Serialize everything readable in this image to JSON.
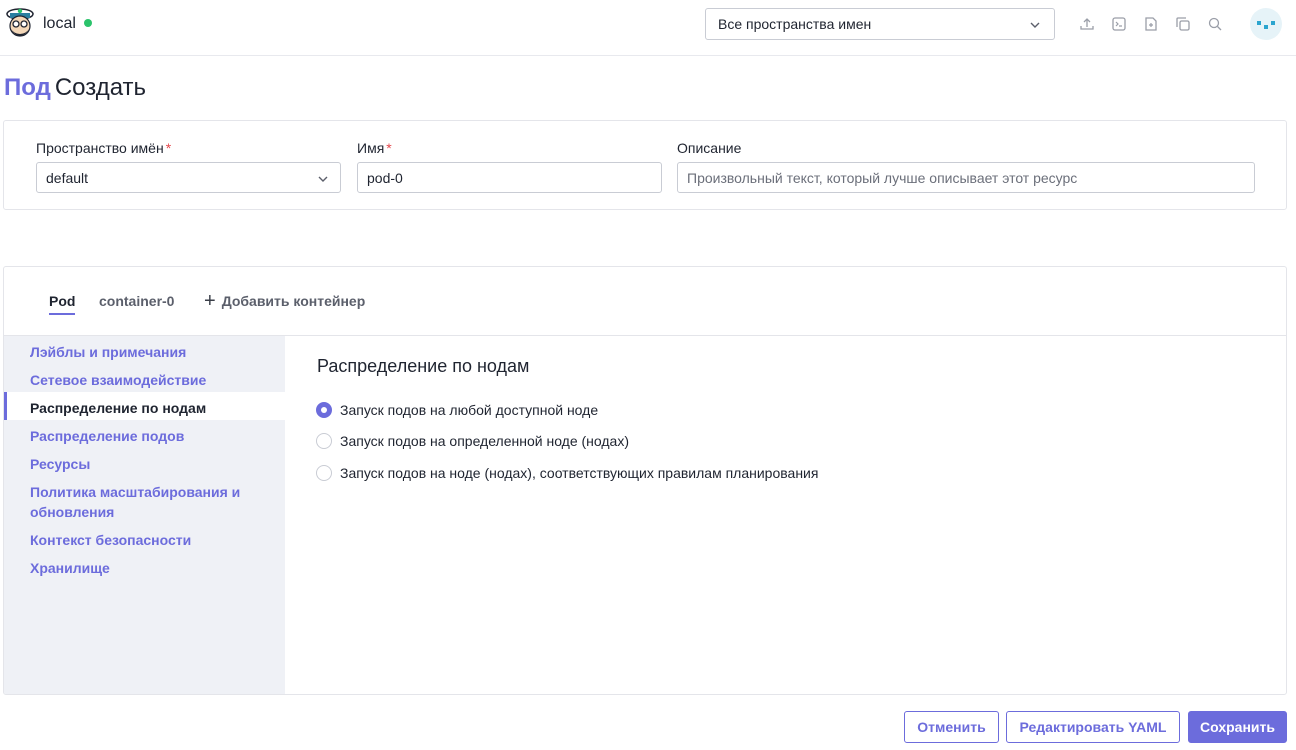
{
  "header": {
    "cluster_name": "local",
    "cluster_status_color": "#2bc36b",
    "namespace_filter": "Все пространства имен",
    "icons": [
      "upload-icon",
      "terminal-icon",
      "file-add-icon",
      "copy-icon",
      "search-icon"
    ]
  },
  "page": {
    "kind": "Под",
    "action": "Создать"
  },
  "form": {
    "namespace_label": "Пространство имён",
    "namespace_value": "default",
    "name_label": "Имя",
    "name_value": "pod-0",
    "description_label": "Описание",
    "description_placeholder": "Произвольный текст, который лучше описывает этот ресурс",
    "required_mark": "*"
  },
  "tabs": {
    "pod": "Pod",
    "container": "container-0",
    "add": "Добавить контейнер"
  },
  "sidebar": {
    "items": [
      {
        "label": "Лэйблы и примечания"
      },
      {
        "label": "Сетевое взаимодействие"
      },
      {
        "label": "Распределение по нодам"
      },
      {
        "label": "Распределение подов"
      },
      {
        "label": "Ресурсы"
      },
      {
        "label": "Политика масштабирования и обновления"
      },
      {
        "label": "Контекст безопасности"
      },
      {
        "label": "Хранилище"
      }
    ],
    "active_index": 2
  },
  "section": {
    "title": "Распределение по нодам",
    "options": [
      {
        "label": "Запуск подов на любой доступной ноде",
        "checked": true
      },
      {
        "label": "Запуск подов на определенной ноде (нодах)",
        "checked": false
      },
      {
        "label": "Запуск подов на ноде (нодах), соответствующих правилам планирования",
        "checked": false
      }
    ]
  },
  "footer": {
    "cancel": "Отменить",
    "edit_yaml": "Редактировать YAML",
    "save": "Сохранить"
  },
  "colors": {
    "accent": "#6c6cdc",
    "required": "#e5484d",
    "sidebar_bg": "#eff1f6"
  }
}
